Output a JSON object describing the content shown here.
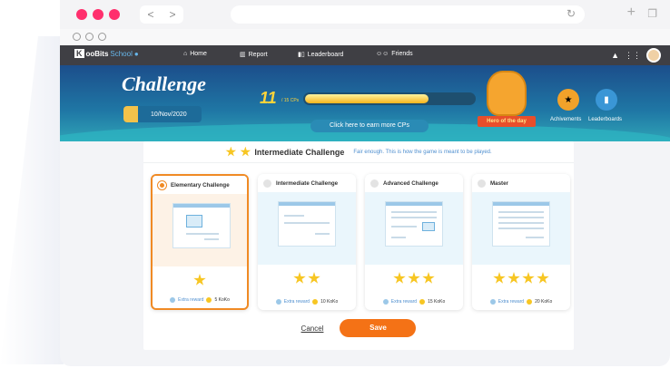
{
  "browser": {
    "back": "<",
    "forward": ">",
    "reload": "↻"
  },
  "nav": {
    "logo_k": "K",
    "logo_main": "ooBits",
    "logo_school": "School",
    "items": [
      {
        "label": "Home"
      },
      {
        "label": "Report"
      },
      {
        "label": "Leaderboard"
      },
      {
        "label": "Friends"
      }
    ]
  },
  "banner": {
    "title": "Challenge",
    "date": "10/Nov/2020",
    "cp_value": "11",
    "cp_max": "/ 15 CPs",
    "cp_progress": 0.73,
    "earn_label": "Click here to earn more CPs",
    "hero_label": "Hero of the day",
    "achievements_label": "Achivements",
    "leaderboards_label": "Leaderboards"
  },
  "panel": {
    "title": "Intermediate Challenge",
    "subtitle": "Fair enough. This is how the game is meant to be played.",
    "cards": [
      {
        "label": "Elementary Challenge",
        "stars": 1,
        "reward_label": "Extra reward",
        "reward_value": "5 KoKo",
        "selected": true
      },
      {
        "label": "Intermediate Challenge",
        "stars": 2,
        "reward_label": "Extra reward",
        "reward_value": "10 KoKo",
        "selected": false
      },
      {
        "label": "Advanced Challenge",
        "stars": 3,
        "reward_label": "Extra reward",
        "reward_value": "15 KoKo",
        "selected": false
      },
      {
        "label": "Master",
        "stars": 4,
        "reward_label": "Extra reward",
        "reward_value": "20 KoKo",
        "selected": false
      }
    ],
    "cancel_label": "Cancel",
    "save_label": "Save"
  },
  "colors": {
    "accent": "#f47216",
    "selected_border": "#f08a24",
    "star": "#f7c623",
    "banner_top": "#1c4e8b",
    "nav_bg": "#3f3f44"
  }
}
